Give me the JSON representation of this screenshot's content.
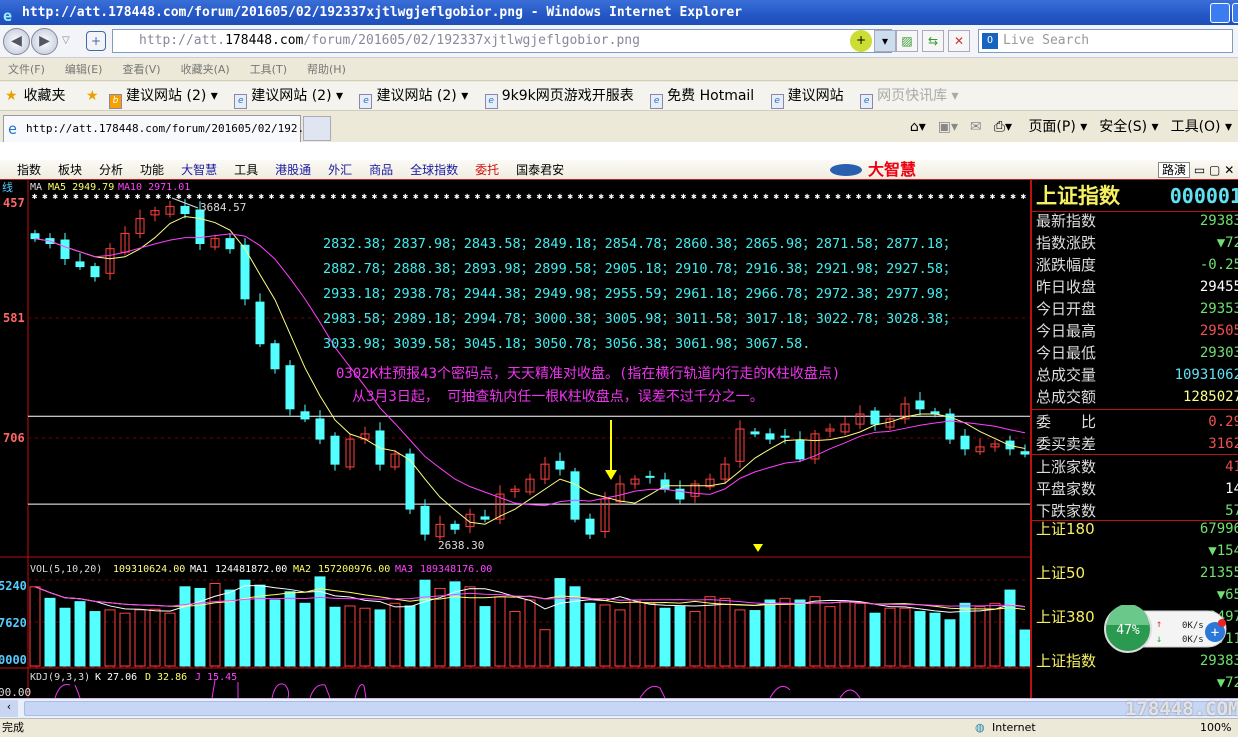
{
  "window": {
    "title": "http://att.178448.com/forum/201605/02/192337xjtlwgjeflgobior.png - Windows Internet Explorer"
  },
  "address": {
    "prefix": "http://att.",
    "host": "178448.com",
    "path": "/forum/201605/02/192337xjtlwgjeflgobior.png",
    "search_placeholder": "Live Search"
  },
  "menu": [
    "文件(F)",
    "编辑(E)",
    "查看(V)",
    "收藏夹(A)",
    "工具(T)",
    "帮助(H)"
  ],
  "favorites": {
    "label": "收藏夹",
    "items": [
      "建议网站 (2) ▾",
      "建议网站 (2) ▾",
      "建议网站 (2) ▾",
      "9k9k网页游戏开服表",
      "免费 Hotmail",
      "建议网站",
      "网页快讯库 ▾"
    ]
  },
  "tab": {
    "title": "http://att.178448.com/forum/201605/02/192..."
  },
  "commands": [
    "页面(P) ▾",
    "安全(S) ▾",
    "工具(O) ▾"
  ],
  "app": {
    "menu": [
      {
        "label": "指数",
        "color": "#000000"
      },
      {
        "label": "板块",
        "color": "#000000"
      },
      {
        "label": "分析",
        "color": "#000000"
      },
      {
        "label": "功能",
        "color": "#000000"
      },
      {
        "label": "大智慧",
        "color": "#1a1aa0"
      },
      {
        "label": "工具",
        "color": "#000000"
      },
      {
        "label": "港股通",
        "color": "#1a1aa0"
      },
      {
        "label": "外汇",
        "color": "#1a1aa0"
      },
      {
        "label": "商品",
        "color": "#1a1aa0"
      },
      {
        "label": "全球指数",
        "color": "#1a1aa0"
      },
      {
        "label": "委托",
        "color": "#d01010"
      },
      {
        "label": "国泰君安",
        "color": "#000000"
      }
    ],
    "brand": "大智慧",
    "right_btn": "路演"
  },
  "chart_header": {
    "left": "线",
    "ma": "MA",
    "ma5": "MA5 2949.79",
    "ma10": "MA10 2971.01"
  },
  "axis_labels": {
    "price": [
      "457",
      "581",
      "706"
    ],
    "volume": [
      "5240",
      "7620",
      "0000"
    ],
    "kdj": "00.00"
  },
  "annotations": {
    "high": "3684.57",
    "low": "2638.30",
    "codes": [
      "2832.38；2837.98；2843.58；2849.18；2854.78；2860.38；2865.98；2871.58；2877.18；",
      "2882.78；2888.38；2893.98；2899.58；2905.18；2910.78；2916.38；2921.98；2927.58；",
      "2933.18；2938.78；2944.38；2949.98；2955.59；2961.18；2966.78；2972.38；2977.98；",
      "2983.58；2989.18；2994.78；3000.38；3005.98；3011.58；3017.18；3022.78；3028.38；",
      "3033.98；3039.58；3045.18；3050.78；3056.38；3061.98；3067.58."
    ],
    "note1": "0302K柱预报43个密码点，天天精准对收盘。(指在横行轨道内行走的K柱收盘点)",
    "note2": "从3月3日起， 可抽查轨内任一根K柱收盘点，误差不过千分之一。"
  },
  "volume_header": {
    "label": "VOL(5,10,20)",
    "vol": "109310624.00",
    "ma1_label": "MA1",
    "ma1": "124481872.00",
    "ma2_label": "MA2",
    "ma2": "157200976.00",
    "ma3_label": "MA3",
    "ma3": "189348176.00"
  },
  "kdj_header": {
    "label": "KDJ(9,3,3)",
    "k": "K 27.06",
    "d": "D 32.86",
    "j": "J 15.45"
  },
  "chart_data": {
    "type": "candlestick",
    "ylim": [
      2610,
      3710
    ],
    "closes": [
      3576,
      3561,
      3515,
      3490,
      3459,
      3545,
      3592,
      3638,
      3662,
      3675,
      3653,
      3561,
      3576,
      3545,
      3391,
      3253,
      3176,
      3053,
      3022,
      2960,
      2883,
      2960,
      2976,
      2883,
      2914,
      2745,
      2668,
      2698,
      2683,
      2729,
      2714,
      2791,
      2806,
      2837,
      2883,
      2868,
      2714,
      2668,
      2776,
      2822,
      2837,
      2843,
      2806,
      2776,
      2822,
      2837,
      2883,
      2991,
      2976,
      2960,
      2966,
      2899,
      2976,
      2991,
      3006,
      3037,
      3006,
      3022,
      3068,
      3053,
      3037,
      2960,
      2930,
      2936,
      2945,
      2930,
      2914
    ],
    "volumes_millions": [
      240,
      205,
      175,
      195,
      165,
      170,
      160,
      170,
      172,
      160,
      240,
      235,
      250,
      230,
      260,
      245,
      200,
      225,
      190,
      270,
      178,
      182,
      175,
      170,
      190,
      182,
      260,
      235,
      255,
      240,
      180,
      210,
      165,
      200,
      110,
      265,
      240,
      190,
      185,
      170,
      200,
      190,
      175,
      180,
      165,
      210,
      205,
      170,
      168,
      200,
      205,
      200,
      210,
      180,
      195,
      190,
      160,
      175,
      175,
      165,
      160,
      140,
      190,
      180,
      190,
      230,
      109
    ],
    "horizontal_lines": [
      3030,
      2760
    ],
    "colors": {
      "up": "#ff4040",
      "down": "#54ffff",
      "ma5": "#ffff80",
      "ma10": "#ff40ff",
      "ma_white": "#ffffff"
    }
  },
  "panel": {
    "title": "上证指数",
    "code": "000001",
    "rows": [
      {
        "label": "最新指数",
        "value": "29383",
        "color": "#70e070"
      },
      {
        "label": "指数涨跌",
        "value": "▼72",
        "color": "#70e070"
      },
      {
        "label": "涨跌幅度",
        "value": "-0.25",
        "color": "#70e070"
      },
      {
        "label": "昨日收盘",
        "value": "29455",
        "color": "#ffffff"
      },
      {
        "label": "今日开盘",
        "value": "29353",
        "color": "#70e070"
      },
      {
        "label": "今日最高",
        "value": "29505",
        "color": "#f05050"
      },
      {
        "label": "今日最低",
        "value": "29303",
        "color": "#70e070"
      },
      {
        "label": "总成交量",
        "value": "10931062",
        "color": "#60e0f0"
      },
      {
        "label": "总成交额",
        "value": "1285027",
        "color": "#ffff90"
      },
      {
        "label": "委　　比",
        "value": "0.29",
        "color": "#f05050"
      },
      {
        "label": "委买卖差",
        "value": "3162",
        "color": "#f05050"
      },
      {
        "label": "上涨家数",
        "value": "41",
        "color": "#f05050"
      },
      {
        "label": "平盘家数",
        "value": "14",
        "color": "#ffffff"
      },
      {
        "label": "下跌家数",
        "value": "57",
        "color": "#70e070"
      }
    ],
    "indices": [
      {
        "label": "上证180",
        "value": "67996",
        "change": "▼154"
      },
      {
        "label": "上证50",
        "value": "21355",
        "change": "▼65"
      },
      {
        "label": "上证380",
        "value": "73497",
        "change": "▼11"
      },
      {
        "label": "上证指数",
        "value": "29383",
        "change": "▼72"
      }
    ]
  },
  "widget": {
    "percent": "47%",
    "up": "0K/s",
    "down": "0K/s"
  },
  "status": {
    "text": "完成",
    "zone": "Internet",
    "zoom": "100%",
    "watermark": "178448.COM"
  }
}
